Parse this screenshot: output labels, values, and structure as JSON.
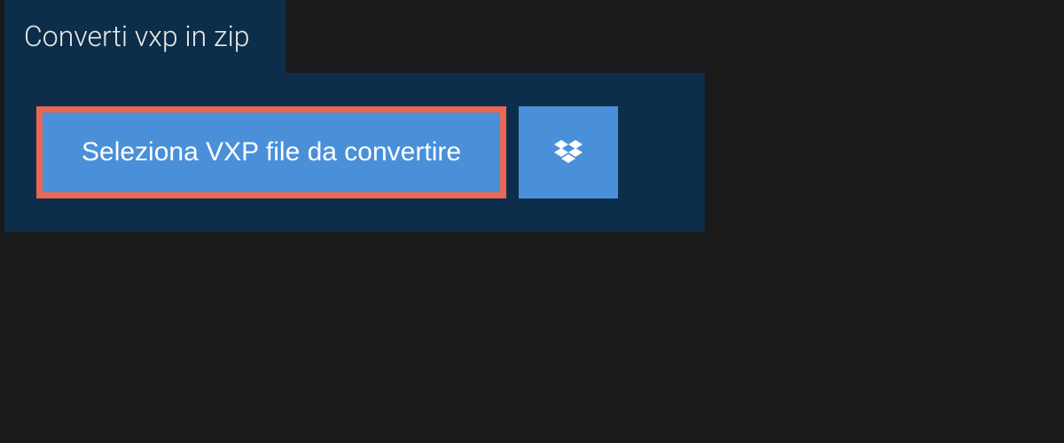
{
  "tab": {
    "label": "Converti vxp in zip"
  },
  "buttons": {
    "select_file_label": "Seleziona VXP file da convertire"
  },
  "colors": {
    "panel_bg": "#0d2e4a",
    "button_bg": "#4a90d9",
    "highlight_border": "#e96855"
  }
}
